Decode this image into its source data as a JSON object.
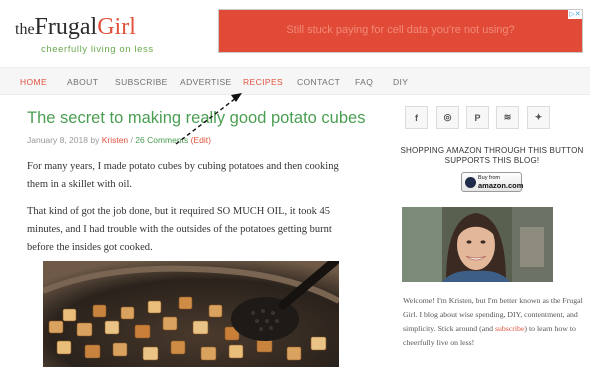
{
  "header": {
    "logo_prefix": "the",
    "logo_main": "Frugal",
    "logo_accent": "Girl",
    "tagline": "cheerfully living on less"
  },
  "ad": {
    "text": "Still stuck paying for cell data you're not using?"
  },
  "nav": {
    "items": [
      "HOME",
      "ABOUT",
      "SUBSCRIBE",
      "ADVERTISE",
      "RECIPES",
      "CONTACT",
      "FAQ",
      "DIY"
    ],
    "active": [
      "HOME",
      "RECIPES"
    ]
  },
  "post": {
    "title": "The secret to making really good potato cubes",
    "date": "January 8, 2018",
    "by": "by",
    "author": "Kristen",
    "separator": "/",
    "comments": "26 Comments",
    "edit": "(Edit)",
    "paragraphs": [
      "For many years, I made potato cubes by cubing potatoes and then cooking them in a skillet with oil.",
      "That kind of got the job done, but it required SO MUCH OIL, it took 45 minutes, and I had trouble with the outsides of the potatoes getting burnt before the insides got cooked."
    ]
  },
  "sidebar": {
    "social_icons": [
      "facebook-icon",
      "instagram-icon",
      "pinterest-icon",
      "rss-icon",
      "twitter-icon"
    ],
    "social_glyphs": {
      "facebook": "f",
      "instagram": "◎",
      "pinterest": "P",
      "rss": "≋",
      "twitter": "✦"
    },
    "amazon_heading": "SHOPPING AMAZON THROUGH THIS BUTTON SUPPORTS THIS BLOG!",
    "amazon_button": {
      "line1": "Buy from",
      "line2": "amazon.com"
    },
    "bio_before_link": "Welcome! I'm Kristen, but I'm better known as the Frugal Girl. I blog about wise spending, DIY, contentment, and simplicity. Stick around (and ",
    "bio_link": "subscribe",
    "bio_after_link": ") to learn how to cheerfully live on less!"
  },
  "colors": {
    "accent_red": "#e1523d",
    "accent_green": "#4a9e52",
    "ad_background": "#e14a36"
  }
}
